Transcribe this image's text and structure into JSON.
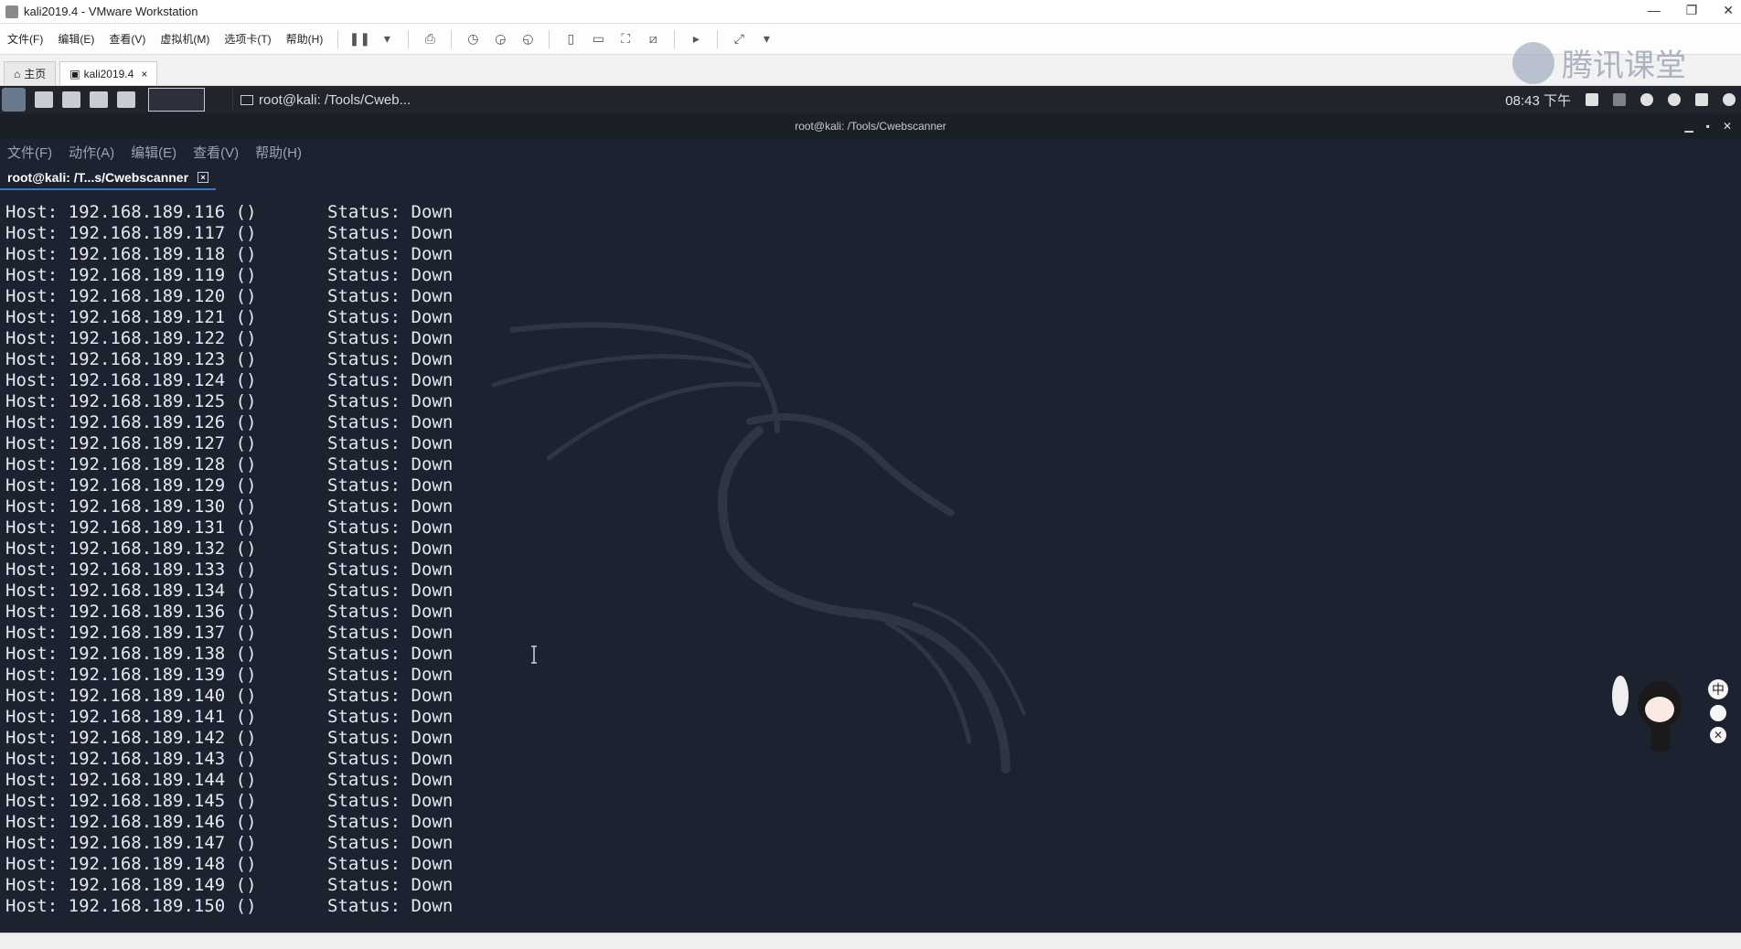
{
  "window": {
    "title": "kali2019.4 - VMware Workstation",
    "controls": [
      "—",
      "❐",
      "✕"
    ]
  },
  "vmware_menu": [
    "文件(F)",
    "编辑(E)",
    "查看(V)",
    "虚拟机(M)",
    "选项卡(T)",
    "帮助(H)"
  ],
  "vm_tabs": [
    {
      "label": "主页"
    },
    {
      "label": "kali2019.4"
    }
  ],
  "watermark": {
    "text": "腾讯课堂"
  },
  "kali_panel": {
    "task_label": "root@kali: /Tools/Cweb...",
    "clock": "08:43 下午"
  },
  "terminal": {
    "title": "root@kali: /Tools/Cwebscanner",
    "menu": [
      "文件(F)",
      "动作(A)",
      "编辑(E)",
      "查看(V)",
      "帮助(H)"
    ],
    "tab_label": "root@kali: /T...s/Cwebscanner",
    "lines": [
      {
        "host": "Host: 192.168.189.116 ()",
        "status": "Status: Down"
      },
      {
        "host": "Host: 192.168.189.117 ()",
        "status": "Status: Down"
      },
      {
        "host": "Host: 192.168.189.118 ()",
        "status": "Status: Down"
      },
      {
        "host": "Host: 192.168.189.119 ()",
        "status": "Status: Down"
      },
      {
        "host": "Host: 192.168.189.120 ()",
        "status": "Status: Down"
      },
      {
        "host": "Host: 192.168.189.121 ()",
        "status": "Status: Down"
      },
      {
        "host": "Host: 192.168.189.122 ()",
        "status": "Status: Down"
      },
      {
        "host": "Host: 192.168.189.123 ()",
        "status": "Status: Down"
      },
      {
        "host": "Host: 192.168.189.124 ()",
        "status": "Status: Down"
      },
      {
        "host": "Host: 192.168.189.125 ()",
        "status": "Status: Down"
      },
      {
        "host": "Host: 192.168.189.126 ()",
        "status": "Status: Down"
      },
      {
        "host": "Host: 192.168.189.127 ()",
        "status": "Status: Down"
      },
      {
        "host": "Host: 192.168.189.128 ()",
        "status": "Status: Down"
      },
      {
        "host": "Host: 192.168.189.129 ()",
        "status": "Status: Down"
      },
      {
        "host": "Host: 192.168.189.130 ()",
        "status": "Status: Down"
      },
      {
        "host": "Host: 192.168.189.131 ()",
        "status": "Status: Down"
      },
      {
        "host": "Host: 192.168.189.132 ()",
        "status": "Status: Down"
      },
      {
        "host": "Host: 192.168.189.133 ()",
        "status": "Status: Down"
      },
      {
        "host": "Host: 192.168.189.134 ()",
        "status": "Status: Down"
      },
      {
        "host": "Host: 192.168.189.136 ()",
        "status": "Status: Down"
      },
      {
        "host": "Host: 192.168.189.137 ()",
        "status": "Status: Down"
      },
      {
        "host": "Host: 192.168.189.138 ()",
        "status": "Status: Down"
      },
      {
        "host": "Host: 192.168.189.139 ()",
        "status": "Status: Down"
      },
      {
        "host": "Host: 192.168.189.140 ()",
        "status": "Status: Down"
      },
      {
        "host": "Host: 192.168.189.141 ()",
        "status": "Status: Down"
      },
      {
        "host": "Host: 192.168.189.142 ()",
        "status": "Status: Down"
      },
      {
        "host": "Host: 192.168.189.143 ()",
        "status": "Status: Down"
      },
      {
        "host": "Host: 192.168.189.144 ()",
        "status": "Status: Down"
      },
      {
        "host": "Host: 192.168.189.145 ()",
        "status": "Status: Down"
      },
      {
        "host": "Host: 192.168.189.146 ()",
        "status": "Status: Down"
      },
      {
        "host": "Host: 192.168.189.147 ()",
        "status": "Status: Down"
      },
      {
        "host": "Host: 192.168.189.148 ()",
        "status": "Status: Down"
      },
      {
        "host": "Host: 192.168.189.149 ()",
        "status": "Status: Down"
      },
      {
        "host": "Host: 192.168.189.150 ()",
        "status": "Status: Down"
      }
    ]
  },
  "ime_widget": {
    "label": "中"
  },
  "colors": {
    "terminal_bg": "#1c2230",
    "terminal_fg": "#e6e8ec",
    "tab_accent": "#3a78c2"
  }
}
